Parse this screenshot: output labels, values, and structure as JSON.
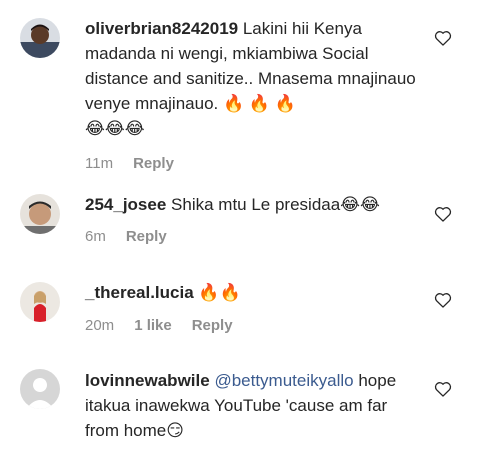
{
  "comments": [
    {
      "username": "oliverbrian8242019",
      "text": "Lakini hii Kenya madanda ni wengi, mkiambiwa Social distance and sanitize.. Mnasema mnajinauo venye mnajinauo. 🔥 🔥 🔥",
      "emoji_line": "😂😂😂",
      "time": "11m",
      "reply_label": "Reply"
    },
    {
      "username": "254_josee",
      "text": "Shika mtu Le presidaa😂😂",
      "time": "6m",
      "reply_label": "Reply"
    },
    {
      "username": "_thereal.lucia",
      "text": "🔥🔥",
      "time": "20m",
      "likes": "1 like",
      "reply_label": "Reply"
    },
    {
      "username": "lovinnewabwile",
      "mention": "@bettymuteikyallo",
      "text": "hope itakua inawekwa YouTube 'cause am far from home😏"
    }
  ],
  "colors": {
    "text": "#262626",
    "meta": "#8e8e8e",
    "mention": "#3b5b8f"
  },
  "icons": {
    "like": "heart-outline-icon"
  }
}
